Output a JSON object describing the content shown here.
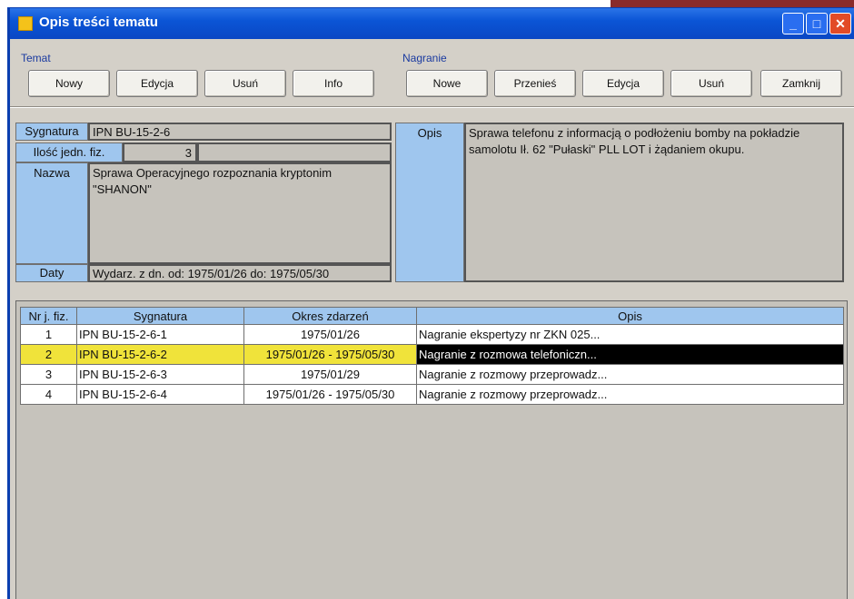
{
  "window": {
    "title": "Opis treści tematu",
    "controls": {
      "minimize": "_",
      "maximize": "□",
      "close": "✕"
    }
  },
  "temat": {
    "label": "Temat",
    "buttons": [
      "Nowy",
      "Edycja",
      "Usuń",
      "Info"
    ]
  },
  "nagranie": {
    "label": "Nagranie",
    "buttons": [
      "Nowe",
      "Przenieś",
      "Edycja",
      "Usuń",
      "Zamknij"
    ]
  },
  "details": {
    "sygnatura_label": "Sygnatura",
    "sygnatura_value": "IPN BU-15-2-6",
    "ilosc_label": "Ilość jedn. fiz.",
    "ilosc_value": "3",
    "nazwa_label": "Nazwa",
    "nazwa_value": "Sprawa Operacyjnego rozpoznania kryptonim \"SHANON\"",
    "daty_label": "Daty",
    "daty_value": "Wydarz. z dn. od: 1975/01/26 do: 1975/05/30",
    "opis_label": "Opis",
    "opis_value": "Sprawa telefonu z informacją o podłożeniu bomby na pokładzie samolotu Ił. 62 \"Pułaski\" PLL LOT i żądaniem okupu."
  },
  "table": {
    "headers": [
      "Nr j. fiz.",
      "Sygnatura",
      "Okres zdarzeń",
      "Opis"
    ],
    "rows": [
      {
        "nr": "1",
        "sygnatura": "IPN BU-15-2-6-1",
        "okres": "1975/01/26",
        "opis": "Nagranie ekspertyzy nr ZKN 025..."
      },
      {
        "nr": "2",
        "sygnatura": "IPN BU-15-2-6-2",
        "okres": "1975/01/26 - 1975/05/30",
        "opis": "Nagranie z rozmowa telefoniczn..."
      },
      {
        "nr": "3",
        "sygnatura": "IPN BU-15-2-6-3",
        "okres": "1975/01/29",
        "opis": "Nagranie z rozmowy przeprowadz..."
      },
      {
        "nr": "4",
        "sygnatura": "IPN BU-15-2-6-4",
        "okres": "1975/01/26 - 1975/05/30",
        "opis": "Nagranie z rozmowy przeprowadz..."
      }
    ],
    "selected_row": 2
  },
  "colors": {
    "titlebar": "#0b55d6",
    "label_bg": "#9fc6ee",
    "field_bg": "#c6c3bc",
    "selection_yellow": "#f0e33a",
    "selection_black": "#000000"
  }
}
